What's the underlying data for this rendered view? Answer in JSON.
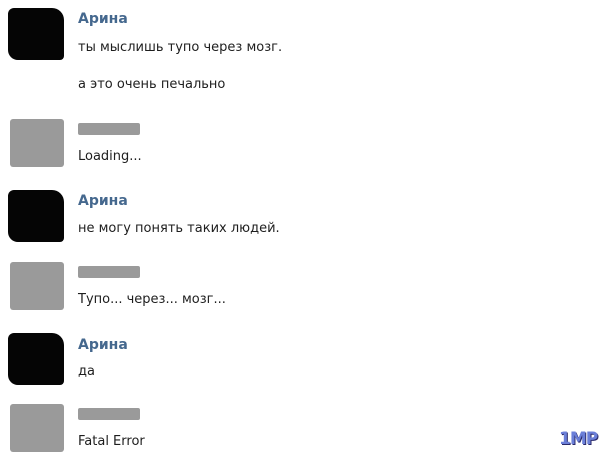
{
  "messages": [
    {
      "author": "Арина",
      "lines": [
        "ты мыслишь тупо через мозг.",
        "а это очень печально"
      ],
      "avatar": "redacted-black"
    },
    {
      "author": "",
      "lines": [
        "Loading..."
      ],
      "avatar": "redacted-gray"
    },
    {
      "author": "Арина",
      "lines": [
        "не могу понять таких людей."
      ],
      "avatar": "redacted-black"
    },
    {
      "author": "",
      "lines": [
        "Тупо... через... мозг..."
      ],
      "avatar": "redacted-gray"
    },
    {
      "author": "Арина",
      "lines": [
        "да"
      ],
      "avatar": "redacted-black"
    },
    {
      "author": "",
      "lines": [
        "Fatal Error"
      ],
      "avatar": "redacted-gray"
    }
  ],
  "watermark": "1MP",
  "colors": {
    "author": "#45688e",
    "text": "#1e1e1e",
    "redaction": "#9a9a9a"
  }
}
